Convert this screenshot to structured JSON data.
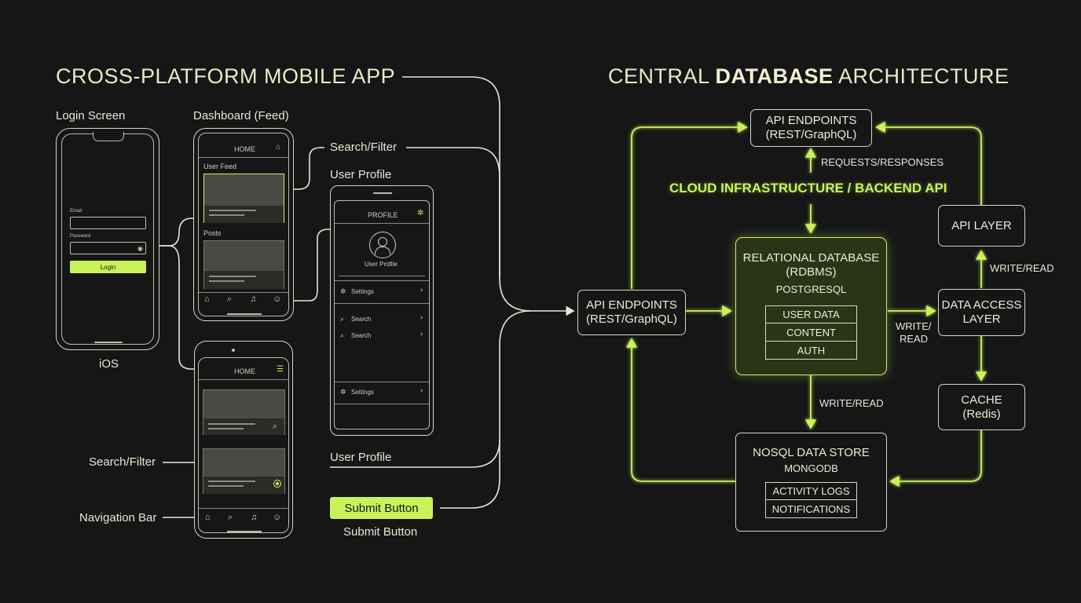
{
  "colors": {
    "background": "#161616",
    "accent": "#c9f35a",
    "line_light": "#d8d6c4",
    "box_fill": "#2a3518"
  },
  "left": {
    "title": "CROSS-PLATFORM MOBILE APP",
    "login_screen": {
      "caption": "Login Screen",
      "email_label": "Email",
      "password_label": "Password",
      "login_button": "Login",
      "platform_label": "iOS"
    },
    "dashboard": {
      "caption": "Dashboard (Feed)",
      "header": "HOME",
      "user_feed_label": "User Feed",
      "posts_label": "Posts"
    },
    "second_phone": {
      "header": "HOME"
    },
    "profile": {
      "caption": "User Profile",
      "header": "PROFILE",
      "avatar_label": "User Profile",
      "menu_items": [
        "Settings",
        "Search",
        "Search",
        "Settings"
      ]
    },
    "callouts": {
      "search_filter_top": "Search/Filter",
      "user_profile_bottom": "User Profile",
      "search_filter_left": "Search/Filter",
      "navigation_bar": "Navigation Bar",
      "submit_button": "Submit Button",
      "submit_button_caption": "Submit Button"
    }
  },
  "right": {
    "title_prefix": "CENTRAL ",
    "title_bold": "DATABASE",
    "title_suffix": " ARCHITECTURE",
    "cloud_label": "CLOUD INFRASTRUCTURE / BACKEND API",
    "api_top": {
      "line1": "API ENDPOINTS",
      "line2": "(REST/GraphQL)"
    },
    "api_left": {
      "line1": "API ENDPOINTS",
      "line2": "(REST/GraphQL)"
    },
    "requests_label": "REQUESTS/RESPONSES",
    "rdbms": {
      "line1": "RELATIONAL DATABASE",
      "line2": "(RDBMS)",
      "engine": "POSTGRESQL",
      "tables": [
        "USER DATA",
        "CONTENT",
        "AUTH"
      ]
    },
    "nosql": {
      "line1": "NOSQL DATA STORE",
      "engine": "MONGODB",
      "collections": [
        "ACTIVITY LOGS",
        "NOTIFICATIONS"
      ]
    },
    "api_layer": "API LAYER",
    "data_access": {
      "line1": "DATA ACCESS",
      "line2": "LAYER"
    },
    "cache": {
      "line1": "CACHE",
      "line2": "(Redis)"
    },
    "write_read_right": "WRITE/READ",
    "write_read_mid_1": "WRITE/",
    "write_read_mid_2": "READ",
    "write_read_bottom": "WRITE/READ"
  }
}
